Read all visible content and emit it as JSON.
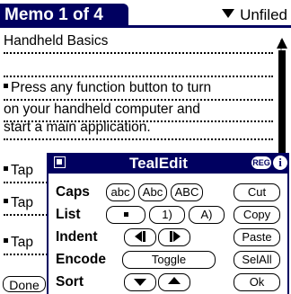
{
  "header": {
    "title": "Memo 1 of 4",
    "category": "Unfiled"
  },
  "memo": {
    "lines": [
      "Handheld Basics",
      "",
      "Press any function button to turn",
      "on your handheld computer and",
      "start a main application.",
      "Tap",
      "Tap",
      "Tap"
    ]
  },
  "done_label": "Done",
  "popup": {
    "title": "TealEdit",
    "reg_badge": "REG",
    "info": "i",
    "rows": {
      "caps": {
        "label": "Caps",
        "buttons": [
          "abc",
          "Abc",
          "ABC"
        ]
      },
      "list": {
        "label": "List",
        "buttons": [
          "•",
          "1)",
          "A)"
        ]
      },
      "indent": {
        "label": "Indent"
      },
      "encode": {
        "label": "Encode",
        "toggle": "Toggle"
      },
      "sort": {
        "label": "Sort"
      }
    },
    "actions": [
      "Cut",
      "Copy",
      "Paste",
      "SelAll",
      "Ok"
    ]
  },
  "colors": {
    "accent": "#000060"
  }
}
